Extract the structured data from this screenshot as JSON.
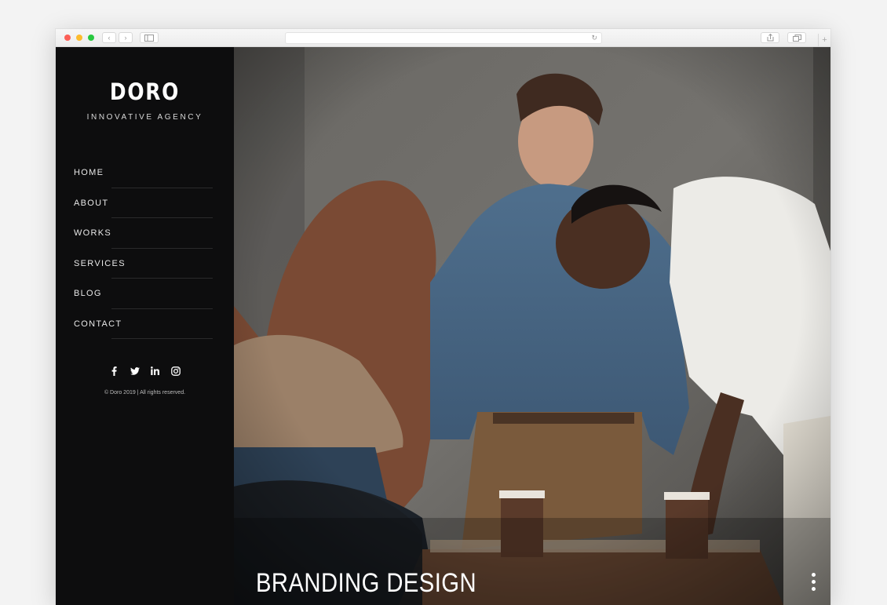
{
  "browser": {
    "window_controls": [
      "close",
      "minimize",
      "zoom"
    ],
    "toolbar_icons": [
      "back-icon",
      "forward-icon",
      "sidebar-icon",
      "reload-icon",
      "share-icon",
      "tabs-icon",
      "new-tab-icon"
    ]
  },
  "brand": {
    "name": "DORO",
    "tagline": "INNOVATIVE AGENCY"
  },
  "nav": {
    "items": [
      {
        "label": "HOME"
      },
      {
        "label": "ABOUT"
      },
      {
        "label": "WORKS"
      },
      {
        "label": "SERVICES"
      },
      {
        "label": "BLOG"
      },
      {
        "label": "CONTACT"
      }
    ]
  },
  "social": [
    "facebook-icon",
    "twitter-icon",
    "linkedin-icon",
    "instagram-icon"
  ],
  "footer": {
    "copyright": "© Doro 2019 | All rights reserved."
  },
  "hero": {
    "caption": "BRANDING DESIGN",
    "image_icon": "team-meeting-photo"
  },
  "colors": {
    "sidebar_bg": "#0d0d0e",
    "text": "#ffffff"
  }
}
